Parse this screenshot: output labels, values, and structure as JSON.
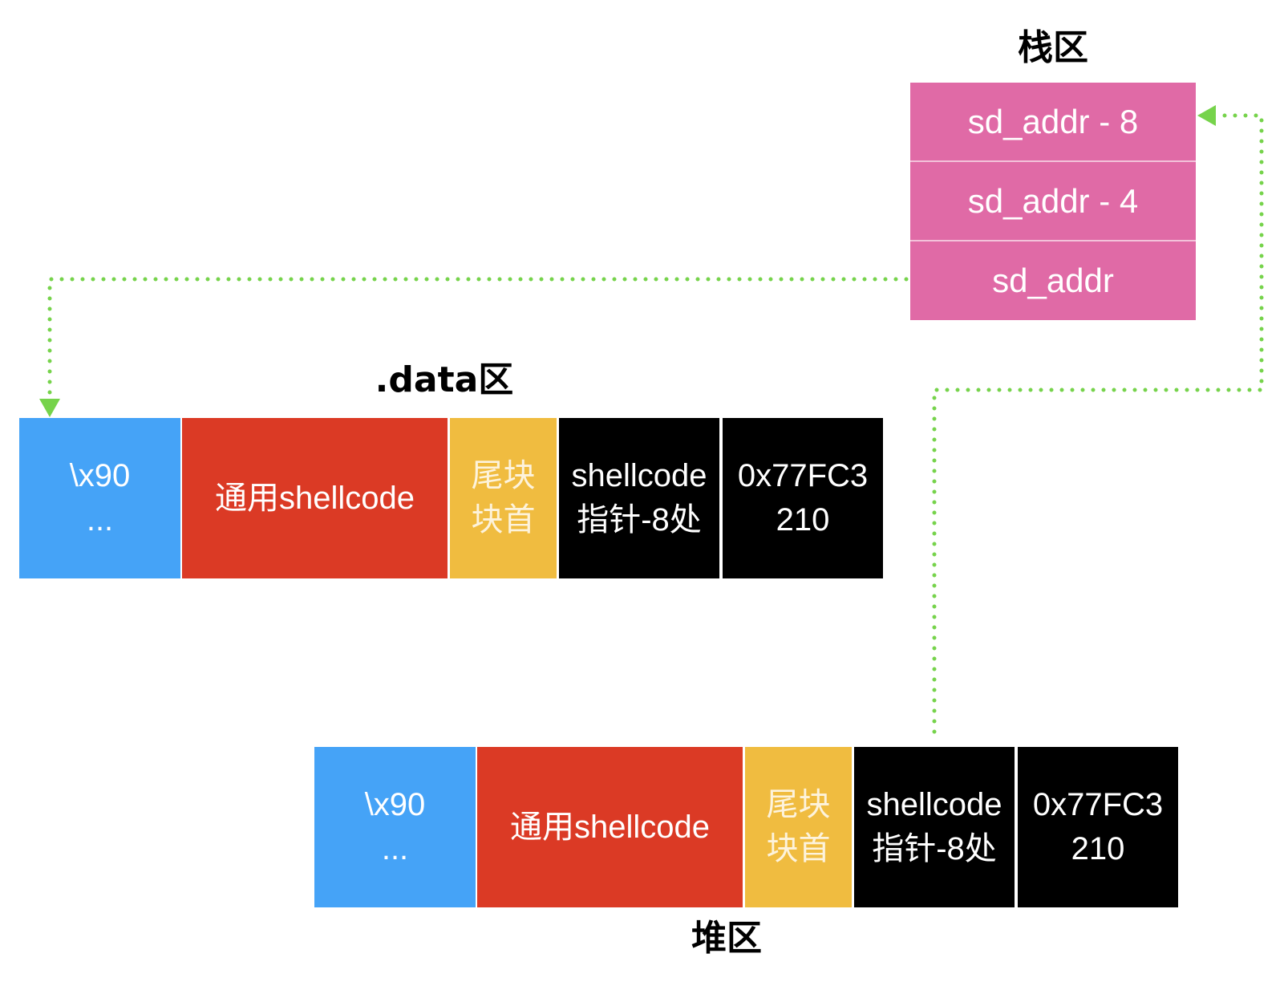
{
  "stack": {
    "title": "栈区",
    "rows": [
      "sd_addr - 8",
      "sd_addr - 4",
      "sd_addr"
    ]
  },
  "data_region": {
    "title": ".data区",
    "cells": [
      {
        "lines": [
          "\\x90",
          "..."
        ]
      },
      {
        "lines": [
          "通用shellcode"
        ]
      },
      {
        "lines": [
          "尾块",
          "块首"
        ]
      },
      {
        "lines": [
          "shellcode",
          "指针-8处"
        ]
      },
      {
        "lines": [
          "0x77FC3",
          "210"
        ]
      }
    ]
  },
  "heap_region": {
    "title": "堆区",
    "cells": [
      {
        "lines": [
          "\\x90",
          "..."
        ]
      },
      {
        "lines": [
          "通用shellcode"
        ]
      },
      {
        "lines": [
          "尾块",
          "块首"
        ]
      },
      {
        "lines": [
          "shellcode",
          "指针-8处"
        ]
      },
      {
        "lines": [
          "0x77FC3",
          "210"
        ]
      }
    ]
  },
  "colors": {
    "nop": "#45a3f7",
    "shellcode": "#db3a25",
    "chunk_header": "#f0bc40",
    "pointer": "#000000",
    "stack": "#e06aa6",
    "link": "#76d34b"
  }
}
